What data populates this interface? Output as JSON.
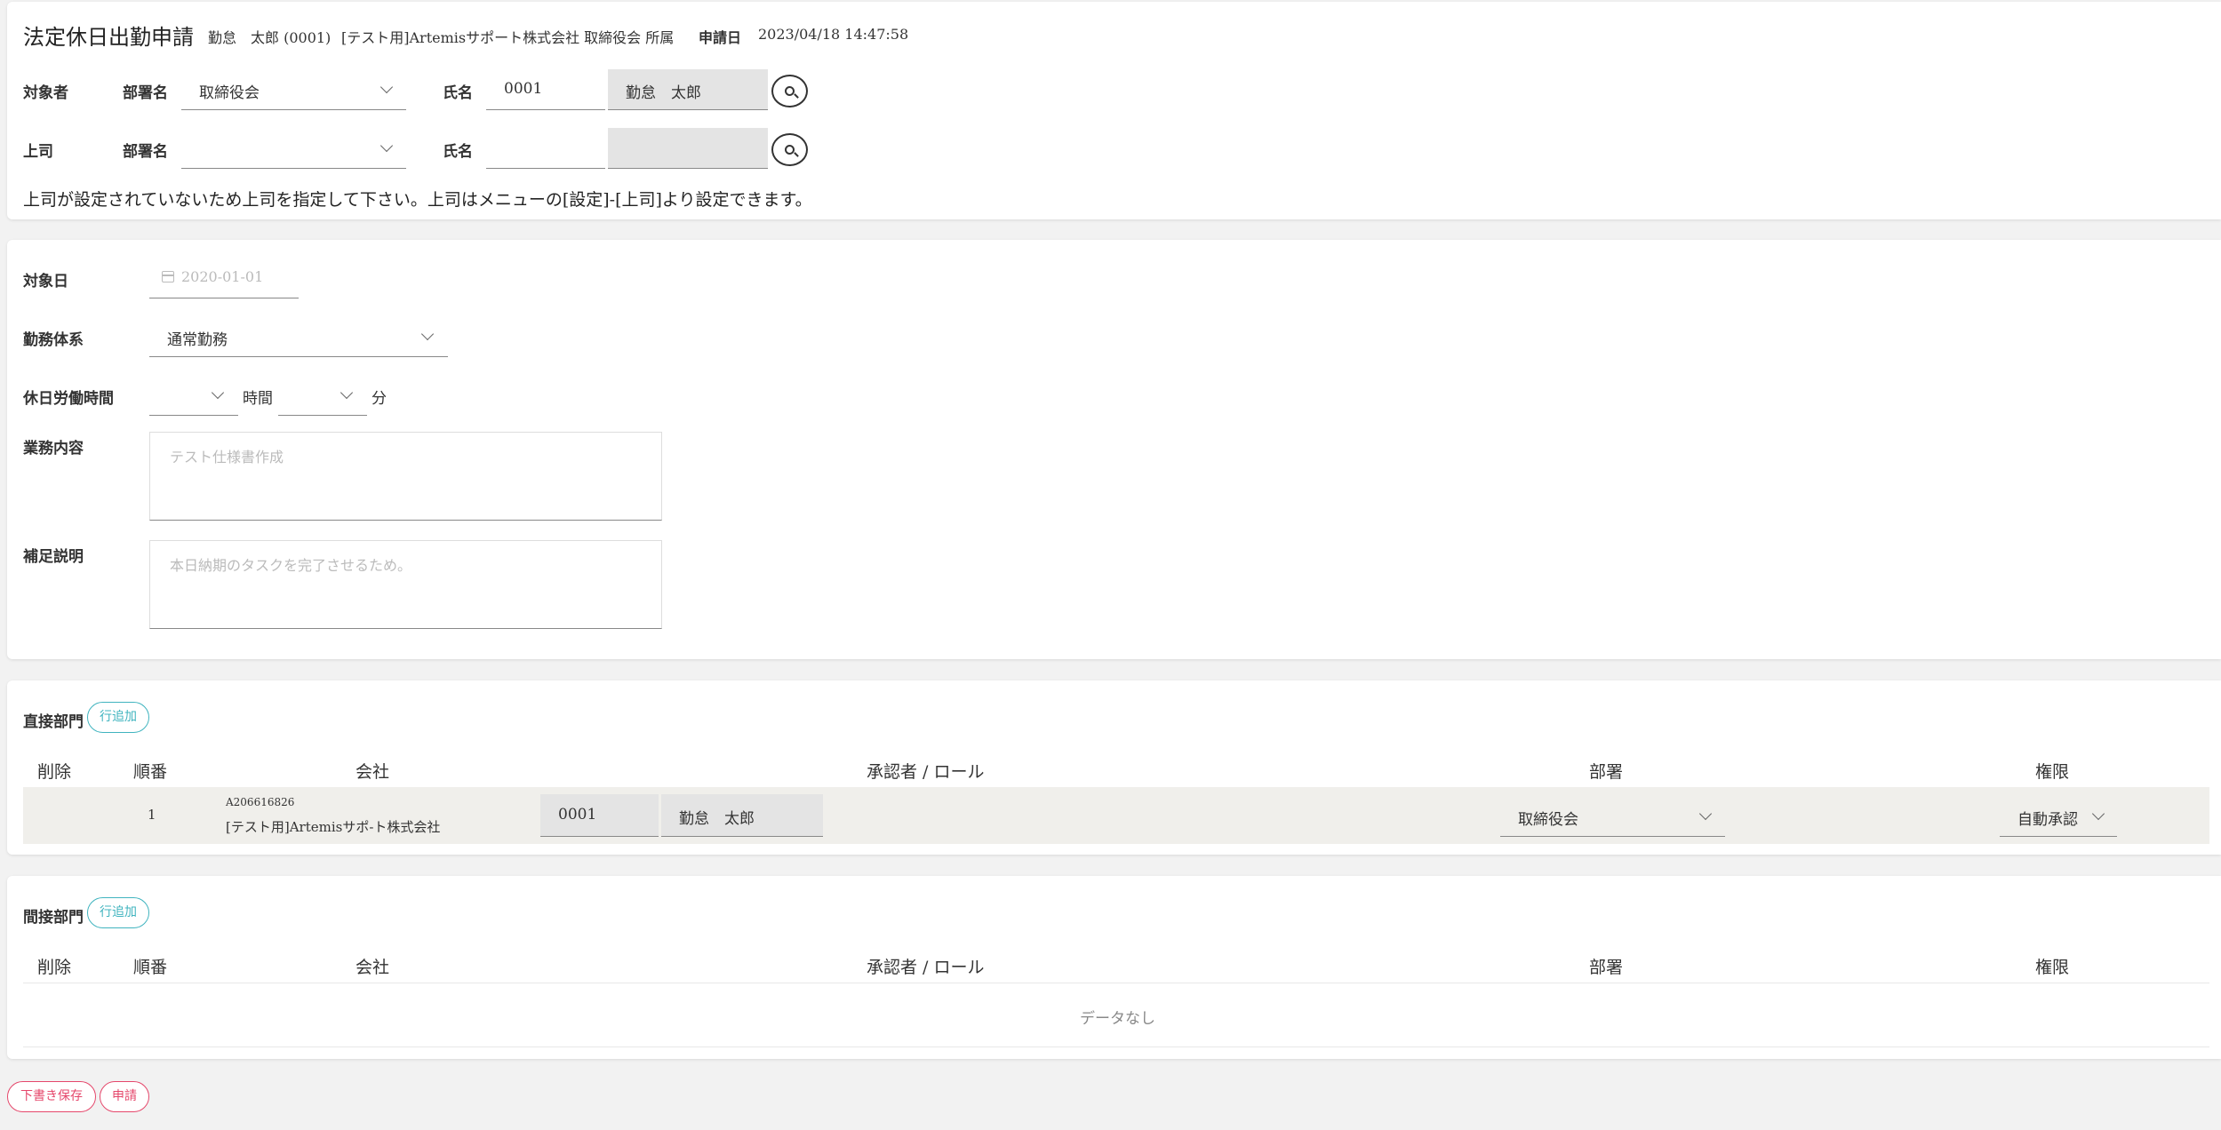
{
  "header": {
    "title": "法定休日出勤申請",
    "applicant": "勤怠　太郎 (0001)",
    "affiliation": "[テスト用]Artemisサポート株式会社 取締役会 所属",
    "date_label": "申請日",
    "date_value": "2023/04/18 14:47:58"
  },
  "target": {
    "row_label": "対象者",
    "dept_label": "部署名",
    "dept_value": "取締役会",
    "name_label": "氏名",
    "code_value": "0001",
    "name_value": "勤怠　太郎"
  },
  "boss": {
    "row_label": "上司",
    "dept_label": "部署名",
    "dept_value": "",
    "name_label": "氏名",
    "code_value": "",
    "name_value": ""
  },
  "warning": "上司が設定されていないため上司を指定して下さい。上司はメニューの[設定]-[上司]より設定できます。",
  "form": {
    "date_label": "対象日",
    "date_placeholder": "2020-01-01",
    "system_label": "勤務体系",
    "system_value": "通常勤務",
    "hours_label": "休日労働時間",
    "hours_value": "",
    "hours_unit": "時間",
    "minutes_value": "",
    "minutes_unit": "分",
    "work_label": "業務内容",
    "work_placeholder": "テスト仕様書作成",
    "note_label": "補足説明",
    "note_placeholder": "本日納期のタスクを完了させるため。"
  },
  "direct": {
    "title": "直接部門",
    "add_label": "行追加",
    "columns": [
      "削除",
      "順番",
      "会社",
      "承認者 / ロール",
      "部署",
      "権限"
    ],
    "rows": [
      {
        "order": "1",
        "company_code": "A206616826",
        "company_name": "[テスト用]Artemisサポ-ト株式会社",
        "approver_code": "0001",
        "approver_name": "勤怠　太郎",
        "dept": "取締役会",
        "authority": "自動承認"
      }
    ]
  },
  "indirect": {
    "title": "間接部門",
    "add_label": "行追加",
    "columns": [
      "削除",
      "順番",
      "会社",
      "承認者 / ロール",
      "部署",
      "権限"
    ],
    "empty_text": "データなし"
  },
  "footer": {
    "draft_label": "下書き保存",
    "submit_label": "申請"
  },
  "colors": {
    "accent_teal": "#40b4bf",
    "accent_red": "#e5476b",
    "field_gray": "#e4e4e4"
  },
  "icons": [
    "calendar-icon",
    "search-icon",
    "chevron-down-icon"
  ]
}
